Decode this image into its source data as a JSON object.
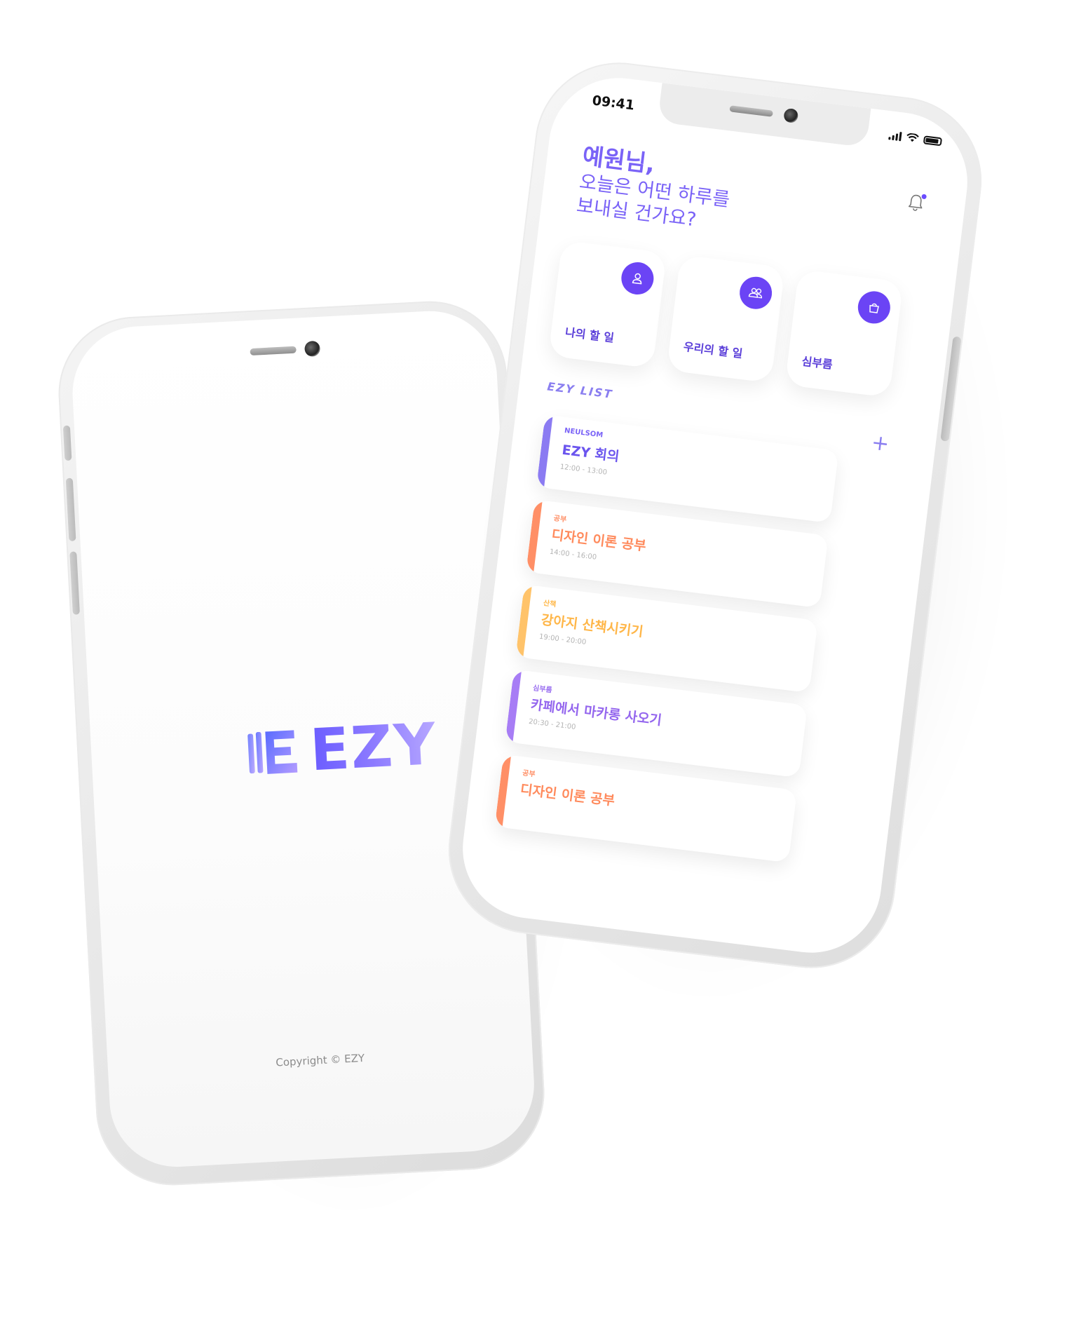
{
  "splash": {
    "brand": "EZY",
    "copyright": "Copyright © EZY"
  },
  "app": {
    "status": {
      "time": "09:41"
    },
    "greeting": {
      "line1": "예원님,",
      "line2": "오늘은 어떤 하루를",
      "line3": "보내실 건가요?"
    },
    "categories": [
      {
        "label": "나의 할 일",
        "icon": "person-icon"
      },
      {
        "label": "우리의 할 일",
        "icon": "group-icon"
      },
      {
        "label": "심부름",
        "icon": "bag-icon"
      }
    ],
    "list": {
      "title": "EZY LIST",
      "add_label": "+",
      "items": [
        {
          "category": "NEULSOM",
          "title": "EZY 회의",
          "time": "12:00 - 13:00",
          "color": "#8b7bf2"
        },
        {
          "category": "공부",
          "title": "디자인 이론 공부",
          "time": "14:00 - 16:00",
          "color": "#ff8f66"
        },
        {
          "category": "산책",
          "title": "강아지 산책시키기",
          "time": "19:00 - 20:00",
          "color": "#ffc36a"
        },
        {
          "category": "심부름",
          "title": "카페에서 마카롱 사오기",
          "time": "20:30 - 21:00",
          "color": "#a77df5"
        },
        {
          "category": "공부",
          "title": "디자인 이론 공부",
          "time": "",
          "color": "#ff8f66"
        }
      ]
    }
  },
  "colors": {
    "accent": "#6b44f5",
    "greeting": "#7a63f7"
  }
}
